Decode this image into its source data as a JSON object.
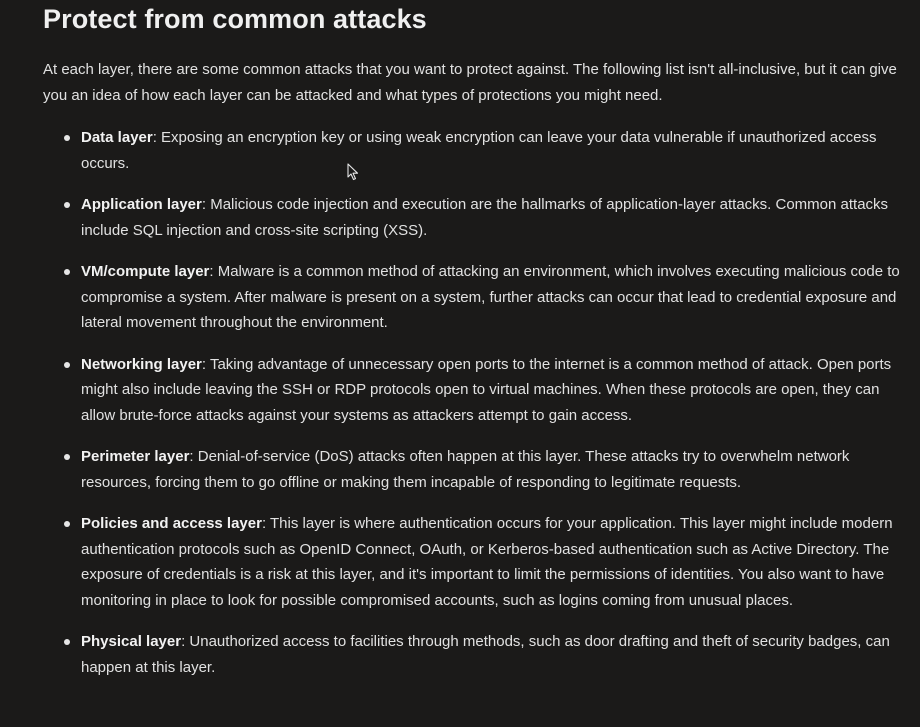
{
  "article": {
    "title": "Protect from common attacks",
    "intro": "At each layer, there are some common attacks that you want to protect against. The following list isn't all-inclusive, but it can give you an idea of how each layer can be attacked and what types of protections you might need.",
    "items": [
      {
        "term": "Data layer",
        "description": ": Exposing an encryption key or using weak encryption can leave your data vulnerable if unauthorized access occurs."
      },
      {
        "term": "Application layer",
        "description": ": Malicious code injection and execution are the hallmarks of application-layer attacks. Common attacks include SQL injection and cross-site scripting (XSS)."
      },
      {
        "term": "VM/compute layer",
        "description": ": Malware is a common method of attacking an environment, which involves executing malicious code to compromise a system. After malware is present on a system, further attacks can occur that lead to credential exposure and lateral movement throughout the environment."
      },
      {
        "term": "Networking layer",
        "description": ": Taking advantage of unnecessary open ports to the internet is a common method of attack. Open ports might also include leaving the SSH or RDP protocols open to virtual machines. When these protocols are open, they can allow brute-force attacks against your systems as attackers attempt to gain access."
      },
      {
        "term": "Perimeter layer",
        "description": ": Denial-of-service (DoS) attacks often happen at this layer. These attacks try to overwhelm network resources, forcing them to go offline or making them incapable of responding to legitimate requests."
      },
      {
        "term": "Policies and access layer",
        "description": ": This layer is where authentication occurs for your application. This layer might include modern authentication protocols such as OpenID Connect, OAuth, or Kerberos-based authentication such as Active Directory. The exposure of credentials is a risk at this layer, and it's important to limit the permissions of identities. You also want to have monitoring in place to look for possible compromised accounts, such as logins coming from unusual places."
      },
      {
        "term": "Physical layer",
        "description": ": Unauthorized access to facilities through methods, such as door drafting and theft of security badges, can happen at this layer."
      }
    ]
  },
  "icons": {
    "cursor": "mouse-pointer-icon"
  }
}
